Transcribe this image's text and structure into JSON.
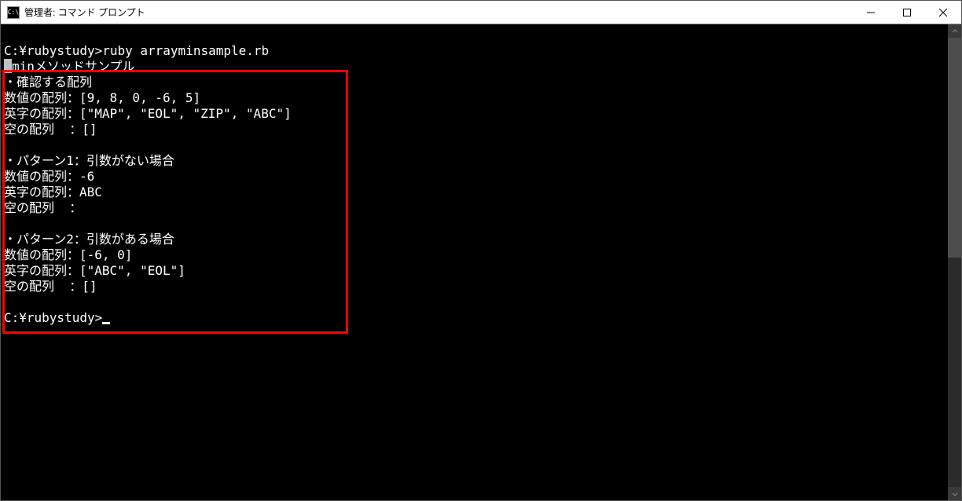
{
  "window": {
    "title": "管理者: コマンド プロンプト",
    "icon_label": "C:\\"
  },
  "terminal": {
    "lines": [
      "",
      "C:¥rubystudy>ruby arrayminsample.rb",
      "■minメソッドサンプル",
      "・確認する配列",
      "数値の配列：[9, 8, 0, -6, 5]",
      "英字の配列：[\"MAP\", \"EOL\", \"ZIP\", \"ABC\"]",
      "空の配列  ：[]",
      "",
      "・パターン1：引数がない場合",
      "数値の配列：-6",
      "英字の配列：ABC",
      "空の配列  ：",
      "",
      "・パターン2：引数がある場合",
      "数値の配列：[-6, 0]",
      "英字の配列：[\"ABC\", \"EOL\"]",
      "空の配列  ：[]",
      "",
      "C:¥rubystudy>"
    ],
    "prompt_cursor": "_"
  }
}
